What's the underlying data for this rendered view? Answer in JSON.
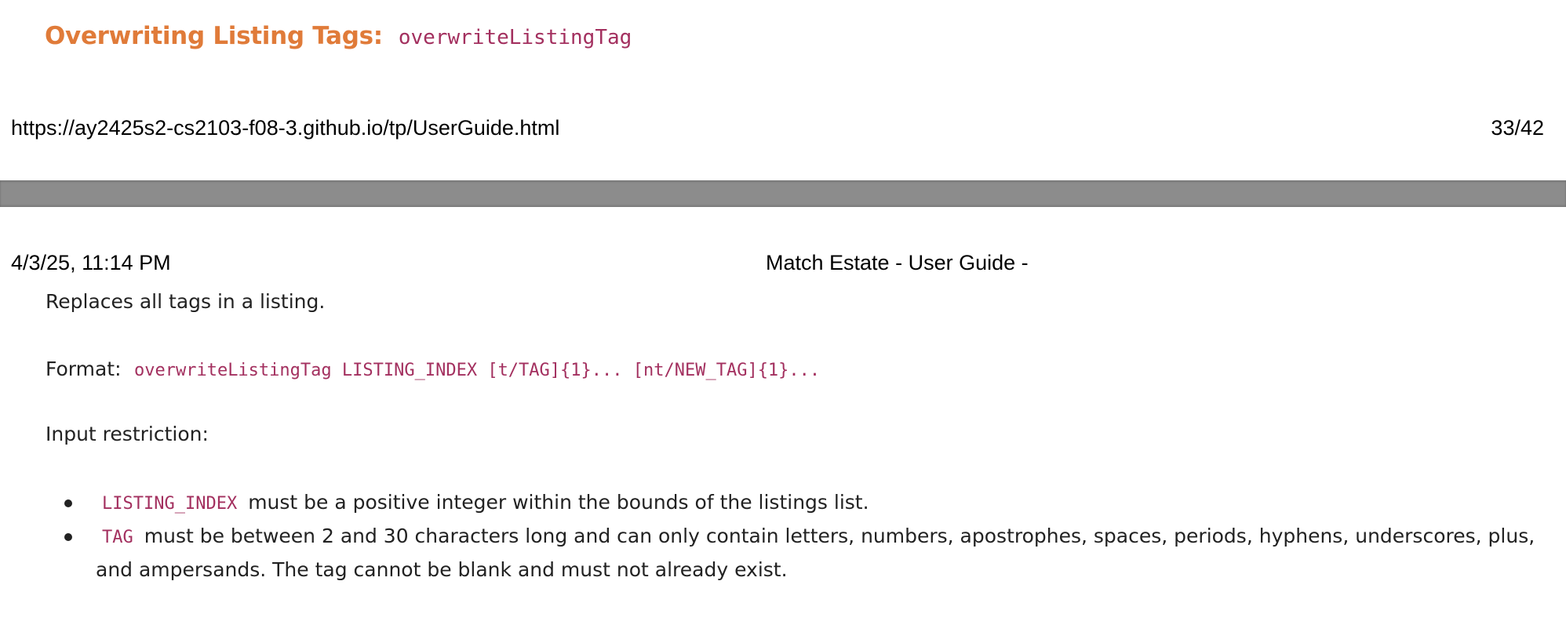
{
  "section": {
    "heading": "Overwriting Listing Tags:",
    "command": "overwriteListingTag"
  },
  "print_footer": {
    "url": "https://ay2425s2-cs2103-f08-3.github.io/tp/UserGuide.html",
    "page_number": "33/42"
  },
  "print_header": {
    "datetime": "4/3/25, 11:14 PM",
    "title": "Match Estate - User Guide -"
  },
  "content": {
    "description": "Replaces all tags in a listing.",
    "format_label": "Format:",
    "format_code": "overwriteListingTag LISTING_INDEX [t/TAG]{1}... [nt/NEW_TAG]{1}...",
    "restriction_label": "Input restriction:",
    "restrictions": [
      {
        "code": "LISTING_INDEX",
        "text": "must be a positive integer within the bounds of the listings list."
      },
      {
        "code": "TAG",
        "text": "must be between 2 and 30 characters long and can only contain letters, numbers, apostrophes, spaces, periods, hyphens, underscores, plus, and ampersands. The tag cannot be blank and must not already exist."
      }
    ]
  },
  "colors": {
    "heading": "#e07b39",
    "code": "#a3305f",
    "page_gap": "#8c8c8c"
  }
}
